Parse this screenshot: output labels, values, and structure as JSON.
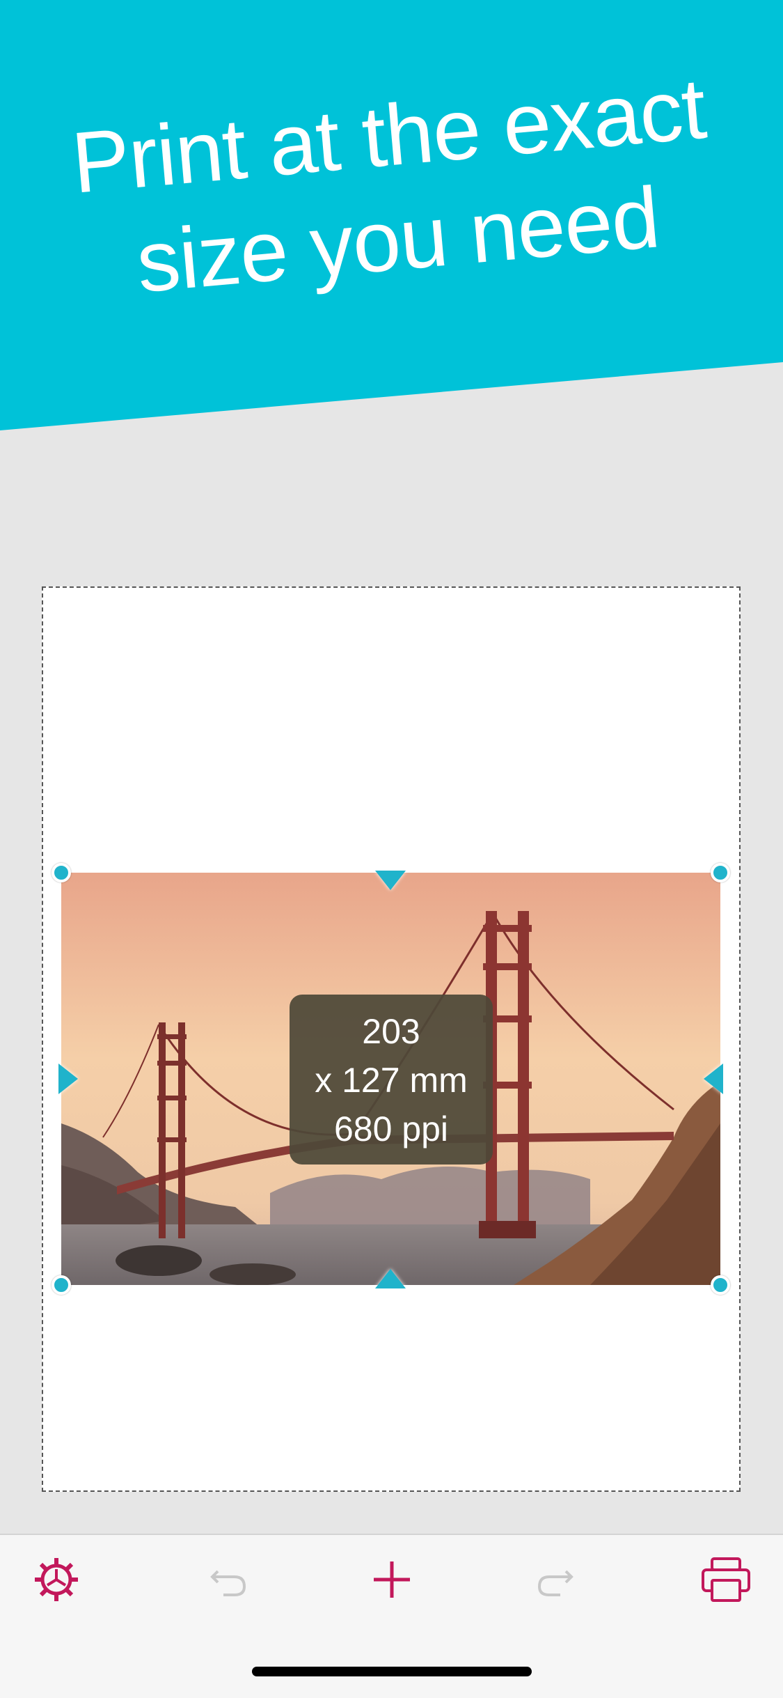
{
  "headline": {
    "line1": "Print at the exact",
    "line2": "size you need"
  },
  "size_info": {
    "width": "203",
    "height": "x 127 mm",
    "resolution": "680 ppi"
  },
  "toolbar": {
    "settings_icon": "gear-icon",
    "undo_icon": "undo-icon",
    "add_icon": "plus-icon",
    "redo_icon": "redo-icon",
    "print_icon": "printer-icon",
    "active_color": "#c2185b",
    "disabled_color": "#c8c8c8"
  },
  "colors": {
    "banner": "#00c2d8",
    "handle": "#20b3cb"
  }
}
